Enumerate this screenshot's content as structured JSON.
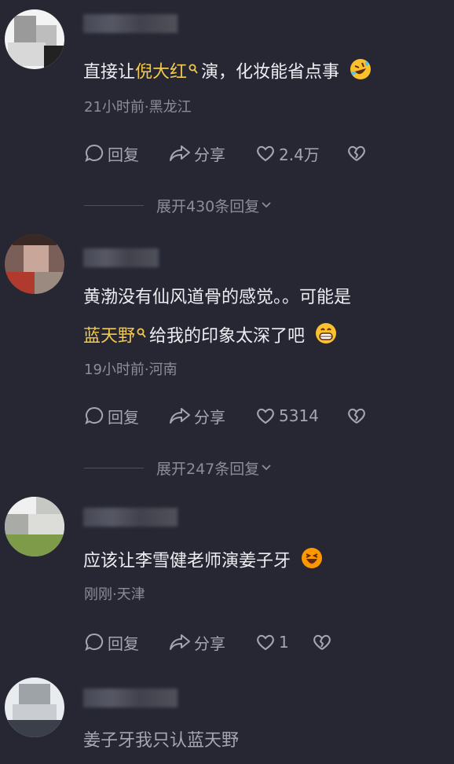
{
  "theme": {
    "background": "#262733",
    "text": "#eeeef2",
    "muted": "#8c8d97",
    "highlight": "#f2c94c"
  },
  "action_labels": {
    "reply": "回复",
    "share": "分享"
  },
  "comments": [
    {
      "text_before": "直接让",
      "highlight": "倪大红",
      "text_after": "演，化妆能省点事",
      "emoji": "rolling-on-floor-laughing",
      "meta": "21小时前·黑龙江",
      "likes": "2.4万",
      "expand_label": "展开430条回复"
    },
    {
      "line1": "黄渤没有仙风道骨的感觉。。可能是",
      "highlight": "蓝天野",
      "text_after": "给我的印象太深了吧",
      "emoji": "grinning-face",
      "meta": "19小时前·河南",
      "likes": "5314",
      "expand_label": "展开247条回复"
    },
    {
      "text": "应该让李雪健老师演姜子牙",
      "emoji": "laughing-face",
      "meta": "刚刚·天津",
      "likes": "1"
    },
    {
      "text": "姜子牙我只认蓝天野"
    }
  ]
}
